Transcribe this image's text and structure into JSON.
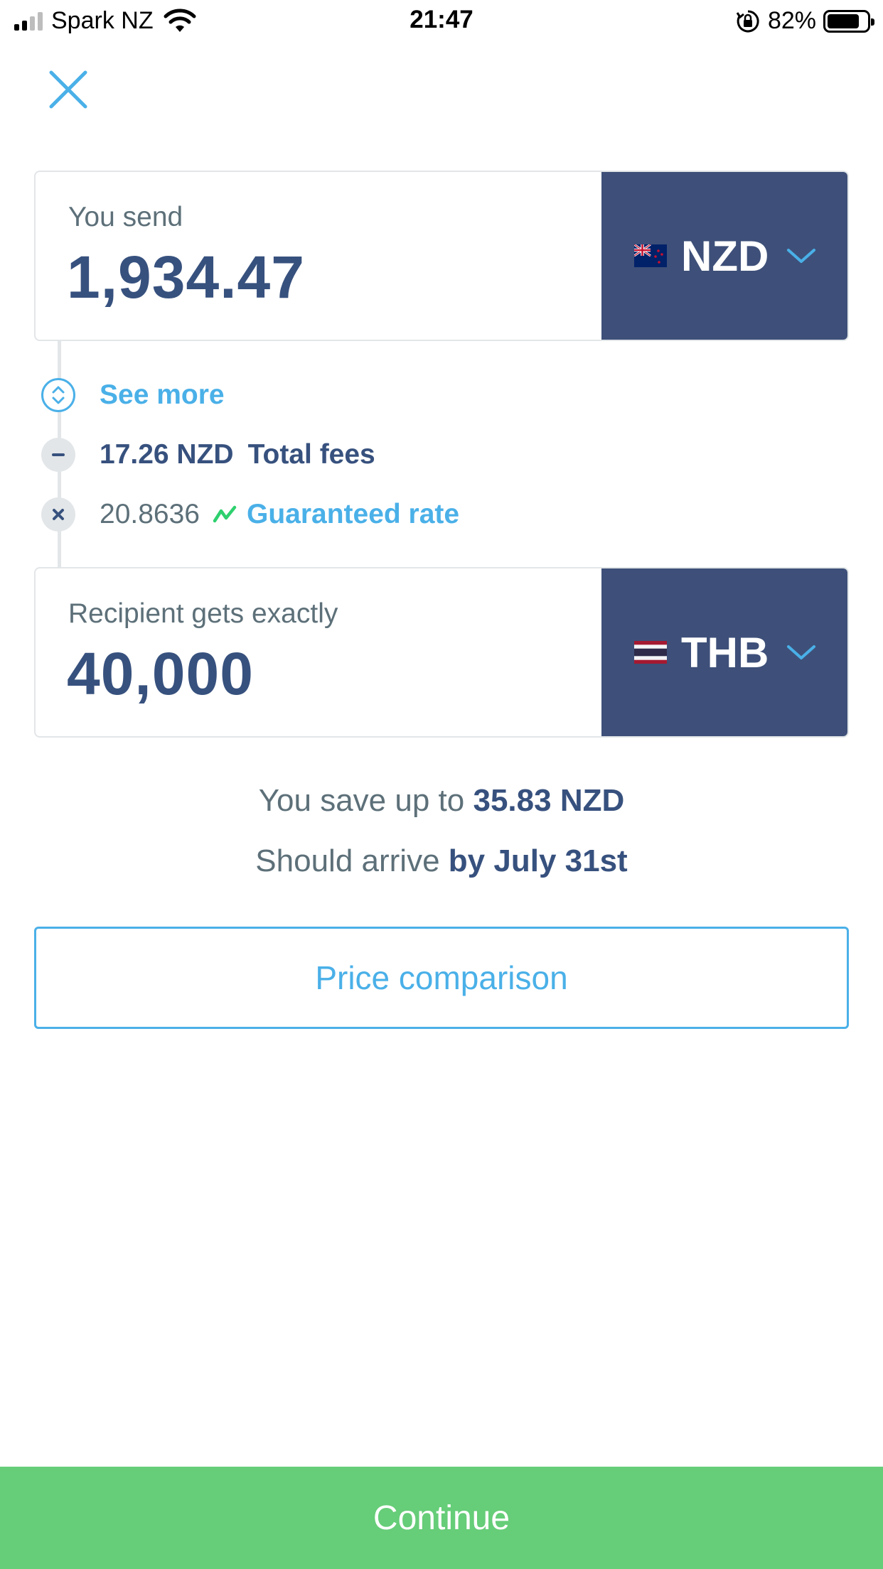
{
  "status_bar": {
    "carrier": "Spark NZ",
    "time": "21:47",
    "battery_percent": "82%",
    "battery_level": 0.82,
    "signal_bars": 4,
    "signal_active": 2
  },
  "close_icon": "close-icon",
  "send": {
    "label": "You send",
    "amount": "1,934.47",
    "currency": "NZD",
    "flag": "nz-flag"
  },
  "details": {
    "see_more": "See more",
    "fee_amount": "17.26 NZD",
    "fee_label": "Total fees",
    "rate": "20.8636",
    "rate_label": "Guaranteed rate"
  },
  "receive": {
    "label": "Recipient gets exactly",
    "amount": "40,000",
    "currency": "THB",
    "flag": "th-flag"
  },
  "summary": {
    "save_prefix": "You save up to",
    "save_amount": "35.83 NZD",
    "arrive_prefix": "Should arrive",
    "arrive_date": "by July 31st"
  },
  "buttons": {
    "price_comparison": "Price comparison",
    "continue": "Continue"
  },
  "colors": {
    "accent": "#4ab0e8",
    "navy": "#37517e",
    "currency_bg": "#3e5079",
    "continue_bg": "#66cd78"
  }
}
